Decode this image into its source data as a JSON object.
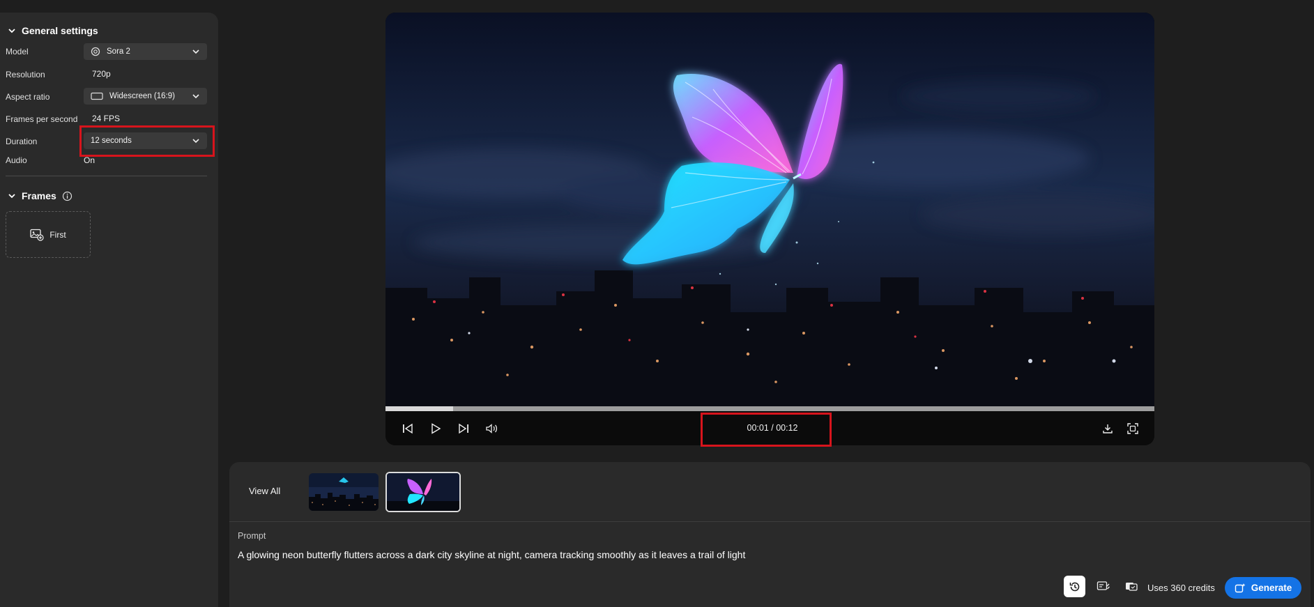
{
  "general_settings": {
    "title": "General settings",
    "rows": {
      "model": {
        "label": "Model",
        "value": "Sora 2",
        "icon": "openai-logo-icon"
      },
      "resolution": {
        "label": "Resolution",
        "value": "720p"
      },
      "aspect_ratio": {
        "label": "Aspect ratio",
        "value": "Widescreen (16:9)",
        "icon": "widescreen-icon"
      },
      "fps": {
        "label": "Frames per second",
        "value": "24 FPS"
      },
      "duration": {
        "label": "Duration",
        "value": "12 seconds"
      },
      "audio": {
        "label": "Audio",
        "value": "On"
      }
    }
  },
  "frames": {
    "title": "Frames",
    "first_label": "First",
    "icon": "add-image-icon"
  },
  "player": {
    "timecode": "00:01 / 00:12",
    "progress": 0.088
  },
  "gallery": {
    "view_all": "View All",
    "thumbnails": [
      {
        "name": "thumbnail-city-skyline",
        "selected": false
      },
      {
        "name": "thumbnail-neon-butterfly",
        "selected": true
      }
    ]
  },
  "prompt": {
    "label": "Prompt",
    "text": "A glowing neon butterfly flutters across a dark city skyline at night, camera tracking smoothly as it leaves a trail of light"
  },
  "footer": {
    "credits": "Uses 360 credits",
    "generate_label": "Generate"
  },
  "colors": {
    "accent": "#1473e6",
    "highlight": "#d7141c",
    "panel": "#2a2a2a",
    "background": "#1e1e1e"
  }
}
